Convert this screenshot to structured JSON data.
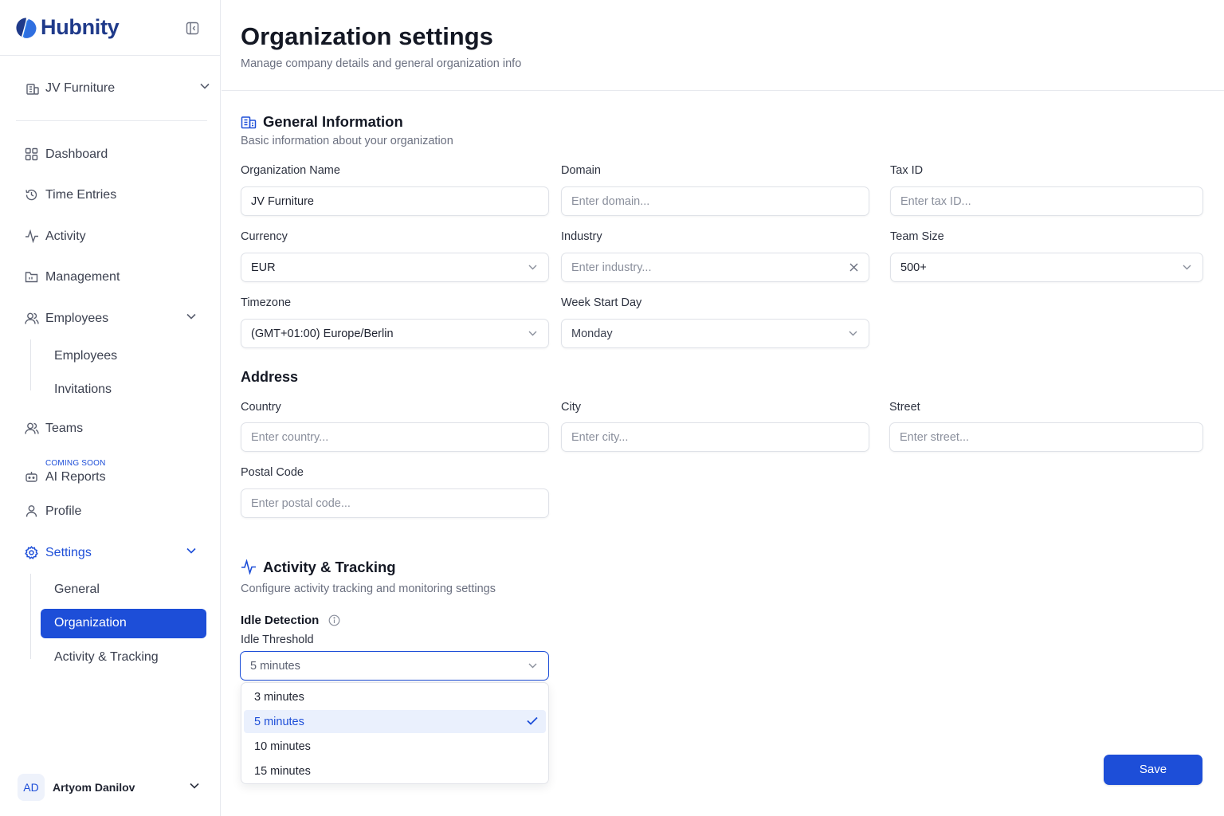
{
  "app": {
    "name": "Hubnity"
  },
  "sidebar": {
    "org_selector": "JV Furniture",
    "nav": {
      "dashboard": "Dashboard",
      "time_entries": "Time Entries",
      "activity": "Activity",
      "management": "Management",
      "employees": "Employees",
      "teams": "Teams",
      "ai_reports": "AI Reports",
      "ai_reports_badge": "COMING SOON",
      "profile": "Profile",
      "settings": "Settings"
    },
    "employees_sub": [
      "Employees",
      "Invitations"
    ],
    "settings_sub": [
      "General",
      "Organization",
      "Activity & Tracking"
    ],
    "active_sub": "Organization",
    "user": {
      "initials": "AD",
      "name": "Artyom Danilov"
    }
  },
  "page": {
    "title": "Organization settings",
    "subtitle": "Manage company details and general organization info"
  },
  "general": {
    "title": "General Information",
    "subtitle": "Basic information about your organization",
    "fields": {
      "org_name": {
        "label": "Organization Name",
        "value": "JV Furniture"
      },
      "domain": {
        "label": "Domain",
        "placeholder": "Enter domain..."
      },
      "tax_id": {
        "label": "Tax ID",
        "placeholder": "Enter tax ID..."
      },
      "currency": {
        "label": "Currency",
        "value": "EUR"
      },
      "industry": {
        "label": "Industry",
        "placeholder": "Enter industry..."
      },
      "team_size": {
        "label": "Team Size",
        "value": "500+"
      },
      "timezone": {
        "label": "Timezone",
        "value": "(GMT+01:00) Europe/Berlin"
      },
      "week_start": {
        "label": "Week Start Day",
        "value": "Monday"
      }
    }
  },
  "address": {
    "title": "Address",
    "fields": {
      "country": {
        "label": "Country",
        "placeholder": "Enter country..."
      },
      "city": {
        "label": "City",
        "placeholder": "Enter city..."
      },
      "street": {
        "label": "Street",
        "placeholder": "Enter street..."
      },
      "postal_code": {
        "label": "Postal Code",
        "placeholder": "Enter postal code..."
      }
    }
  },
  "tracking": {
    "title": "Activity & Tracking",
    "subtitle": "Configure activity tracking and monitoring settings",
    "idle_title": "Idle Detection",
    "idle_threshold_label": "Idle Threshold",
    "idle_threshold_value": "5 minutes",
    "options": [
      "3 minutes",
      "5 minutes",
      "10 minutes",
      "15 minutes"
    ],
    "selected_option": "5 minutes"
  },
  "actions": {
    "save": "Save"
  },
  "colors": {
    "accent": "#1d4ed8",
    "brand_text": "#1f3a8a",
    "selected_bg": "#eaf0fd"
  }
}
